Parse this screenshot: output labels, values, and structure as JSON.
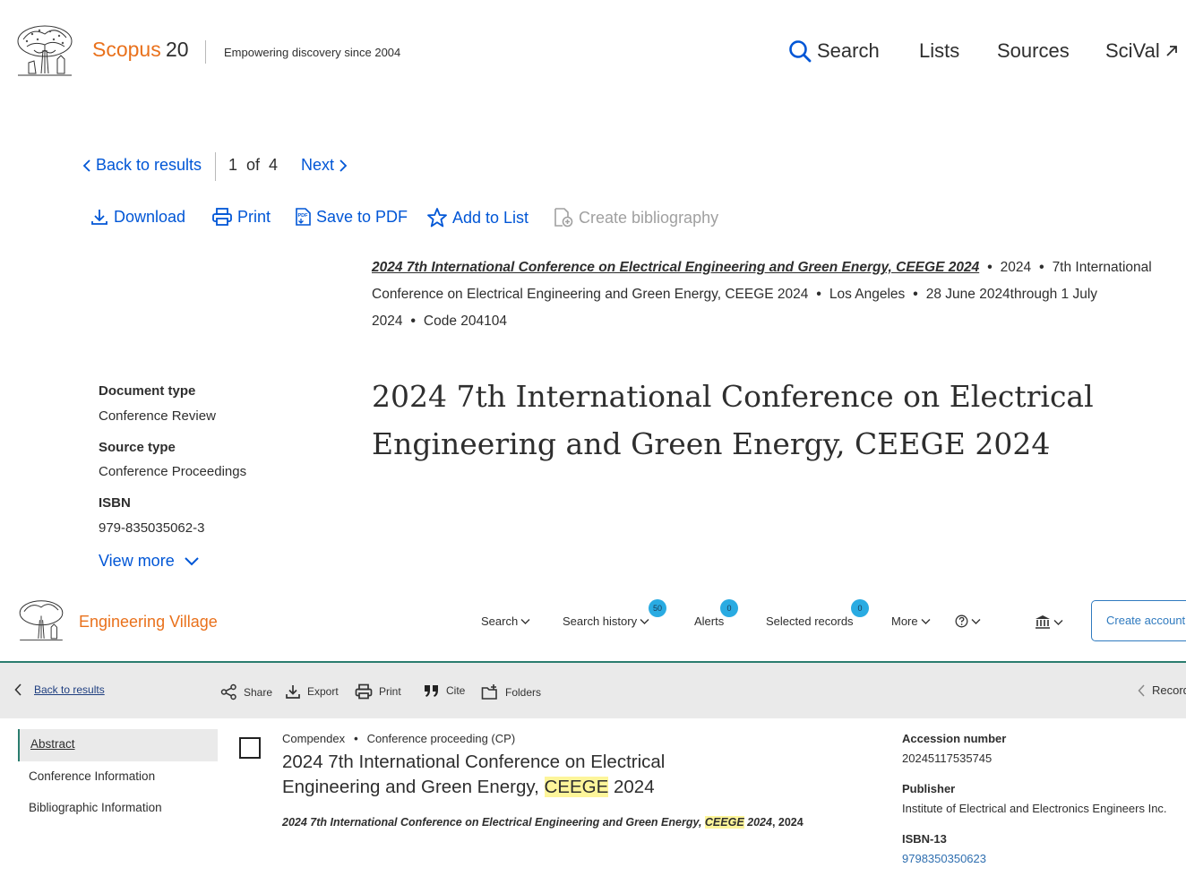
{
  "scopus": {
    "brand": "Scopus",
    "brand_suffix": "20",
    "tagline": "Empowering discovery since 2004",
    "nav": {
      "search": "Search",
      "lists": "Lists",
      "sources": "Sources",
      "scival": "SciVal"
    },
    "pager": {
      "back": "Back to results",
      "current": "1",
      "of": "of",
      "total": "4",
      "next": "Next"
    },
    "actions": {
      "download": "Download",
      "print": "Print",
      "save_pdf": "Save to PDF",
      "add_list": "Add to List",
      "create_bib": "Create bibliography"
    },
    "source_line": {
      "title": "2024 7th International Conference on Electrical Engineering and Green Energy, CEEGE 2024",
      "year": "2024",
      "conference": "7th International Conference on Electrical Engineering and Green Energy, CEEGE 2024",
      "location": "Los Angeles",
      "dates": "28 June 2024through 1 July 2024",
      "code": "Code 204104"
    },
    "doc_title": "2024 7th International Conference on Electrical Engineering and Green Energy, CEEGE 2024",
    "meta": {
      "doc_type_label": "Document type",
      "doc_type": "Conference Review",
      "source_type_label": "Source type",
      "source_type": "Conference Proceedings",
      "isbn_label": "ISBN",
      "isbn": "979-835035062-3",
      "view_more": "View more"
    },
    "colors": {
      "brand": "#e9711c",
      "link": "#0056d6"
    }
  },
  "ev": {
    "brand": "Engineering Village",
    "nav": {
      "search": "Search",
      "history": "Search history",
      "history_count": "50",
      "alerts": "Alerts",
      "alerts_count": "0",
      "selected": "Selected records",
      "selected_count": "0",
      "more": "More",
      "create_account": "Create account"
    },
    "toolbar": {
      "back": "Back to results",
      "share": "Share",
      "export": "Export",
      "print": "Print",
      "cite": "Cite",
      "folders": "Folders",
      "record": "Record"
    },
    "sidebar": [
      "Abstract",
      "Conference Information",
      "Bibliographic Information"
    ],
    "record": {
      "database": "Compendex",
      "doc_type": "Conference proceeding (CP)",
      "title_pre": "2024 7th International Conference on Electrical Engineering and Green Energy, ",
      "title_hl": "CEEGE",
      "title_post": " 2024",
      "source_pre": "2024 7th International Conference on Electrical Engineering and Green Energy, ",
      "source_hl": "CEEGE",
      "source_post": " 2024",
      "source_year": ", 2024"
    },
    "details": {
      "accession_label": "Accession number",
      "accession": "20245117535745",
      "publisher_label": "Publisher",
      "publisher": "Institute of Electrical and Electronics Engineers Inc.",
      "isbn13_label": "ISBN-13",
      "isbn13": "9798350350623"
    },
    "colors": {
      "brand": "#e9711c",
      "accent": "#2b7d6f",
      "badge": "#29abe2",
      "highlight": "#fdf59a"
    }
  }
}
